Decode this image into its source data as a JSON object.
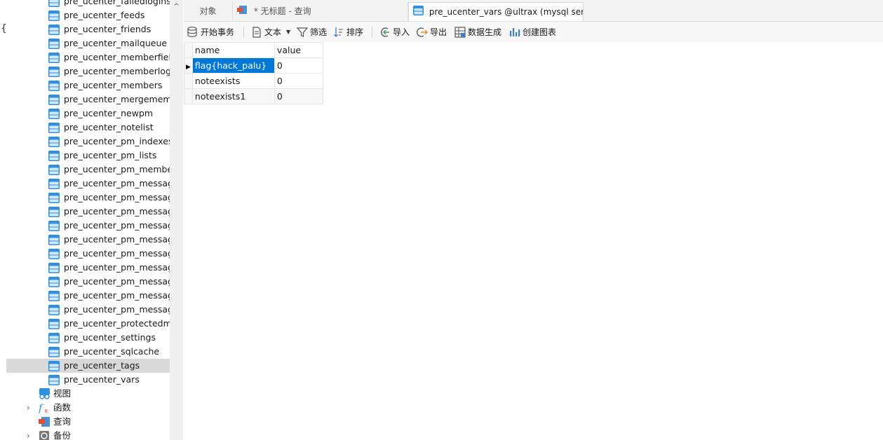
{
  "navigator": {
    "tables": [
      "pre_ucenter_failedlogins",
      "pre_ucenter_feeds",
      "pre_ucenter_friends",
      "pre_ucenter_mailqueue",
      "pre_ucenter_memberfields",
      "pre_ucenter_memberlogs",
      "pre_ucenter_members",
      "pre_ucenter_mergemembe",
      "pre_ucenter_newpm",
      "pre_ucenter_notelist",
      "pre_ucenter_pm_indexes",
      "pre_ucenter_pm_lists",
      "pre_ucenter_pm_members",
      "pre_ucenter_pm_messages",
      "pre_ucenter_pm_messages",
      "pre_ucenter_pm_messages",
      "pre_ucenter_pm_messages",
      "pre_ucenter_pm_messages",
      "pre_ucenter_pm_messages",
      "pre_ucenter_pm_messages",
      "pre_ucenter_pm_messages",
      "pre_ucenter_pm_messages",
      "pre_ucenter_pm_messages",
      "pre_ucenter_protectedmen",
      "pre_ucenter_settings",
      "pre_ucenter_sqlcache",
      "pre_ucenter_tags",
      "pre_ucenter_vars"
    ],
    "selected_index": 26,
    "groups": [
      {
        "label": "视图",
        "icon": "view-icon",
        "expandable": false
      },
      {
        "label": "函数",
        "icon": "function-icon",
        "expandable": true
      },
      {
        "label": "查询",
        "icon": "query-icon",
        "expandable": false
      },
      {
        "label": "备份",
        "icon": "backup-icon",
        "expandable": true
      }
    ]
  },
  "tabs": {
    "objects": "对象",
    "query": "* 无标题 - 查询",
    "active": "pre_ucenter_vars @ultrax (mysql ser..."
  },
  "toolbar": {
    "begin_transaction": "开始事务",
    "text": "文本",
    "filter": "筛选",
    "sort": "排序",
    "import": "导入",
    "export": "导出",
    "data_generation": "数据生成",
    "create_chart": "创建图表"
  },
  "grid": {
    "columns": [
      "name",
      "value"
    ],
    "rows": [
      {
        "name": "flag{hack_palu}",
        "value": "0"
      },
      {
        "name": "noteexists",
        "value": "0"
      },
      {
        "name": "noteexists1",
        "value": "0"
      }
    ],
    "selected_row": 0
  },
  "colors": {
    "selection": "#0078d7",
    "table_icon": "#2f8fe0",
    "tree_selected": "#d9d9d9"
  }
}
